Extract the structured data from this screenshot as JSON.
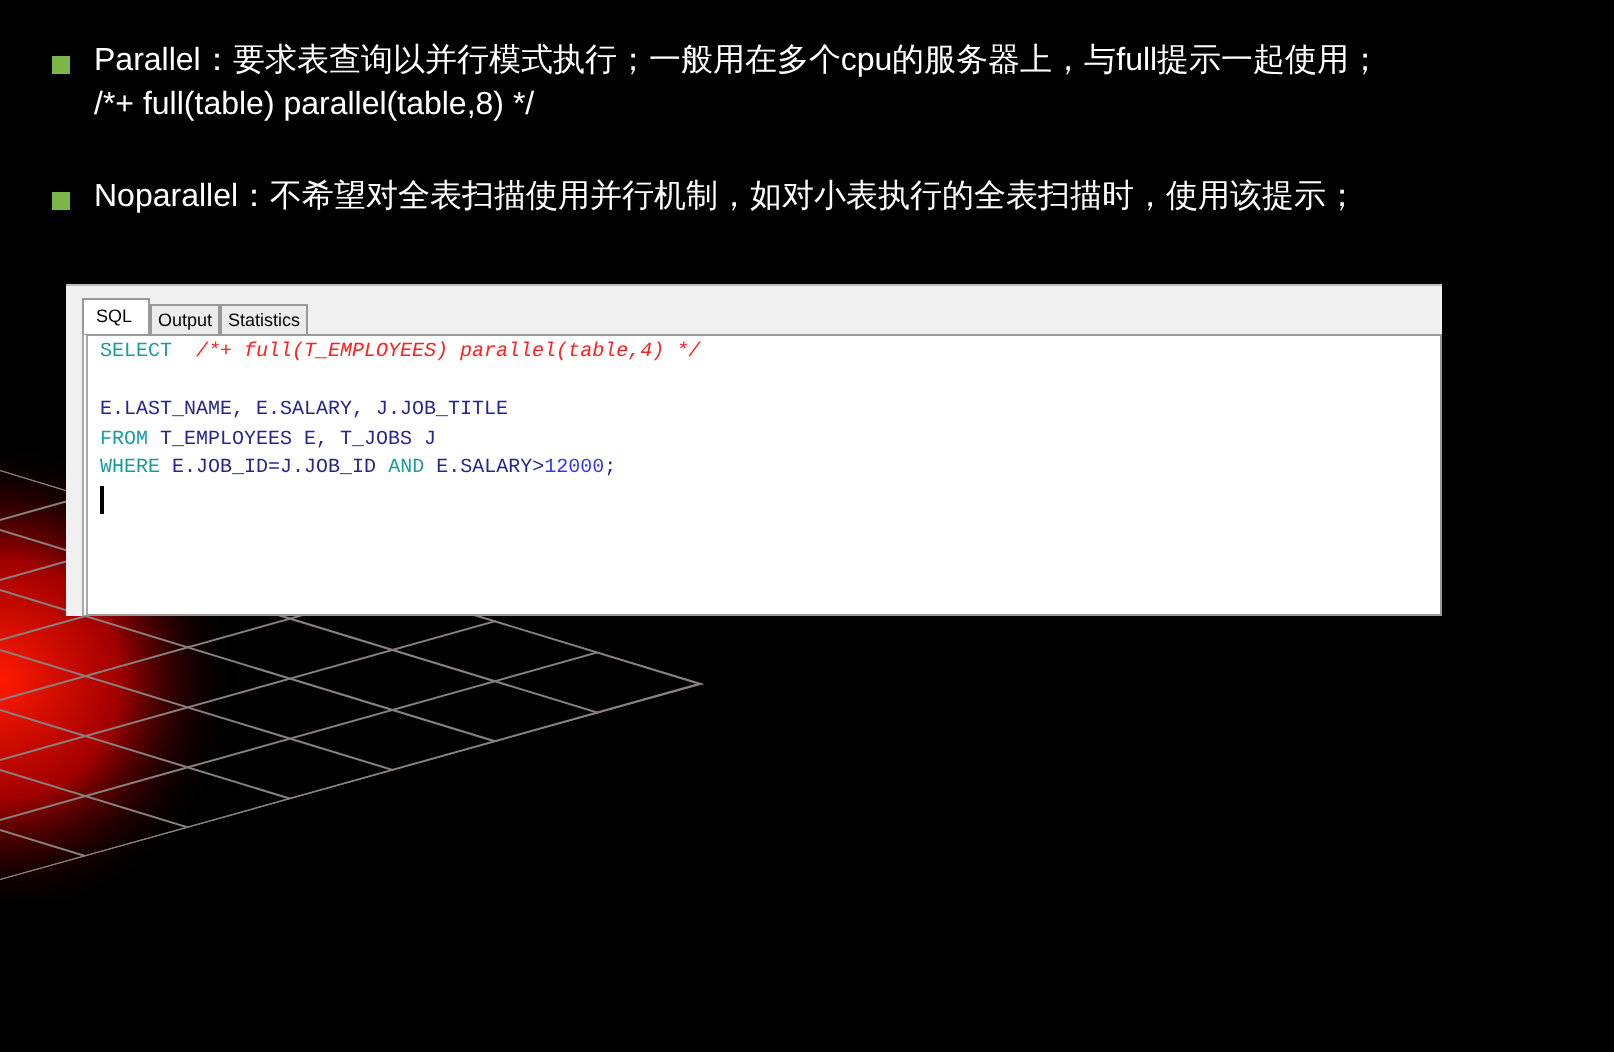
{
  "bullets": [
    {
      "term": "Parallel",
      "text": "：要求表查询以并行模式执行；一般用在多个cpu的服务器上，与full提示一起使用；",
      "example": "/*+ full(table) parallel(table,8) */"
    },
    {
      "term": "Noparallel",
      "text": "：不希望对全表扫描使用并行机制，如对小表执行的全表扫描时，使用该提示；"
    }
  ],
  "editor": {
    "tabs": [
      {
        "label": "SQL",
        "selected": true
      },
      {
        "label": "Output",
        "selected": false
      },
      {
        "label": "Statistics",
        "selected": false
      }
    ],
    "blocks": [
      [
        [
          {
            "kind": "keyword",
            "text": "SELECT"
          },
          {
            "kind": "comment",
            "text": "/*+ full(T_EMPLOYEES) parallel(table,4) */"
          }
        ]
      ],
      [
        [
          {
            "kind": "ident",
            "text": "E.LAST_NAME, E.SALARY, J.JOB_TITLE"
          }
        ],
        [
          {
            "kind": "keyword",
            "text": "FROM"
          },
          {
            "kind": "ident",
            "text": "T_EMPLOYEES E, T_JOBS J"
          }
        ],
        [
          {
            "kind": "keyword",
            "text": "WHERE"
          },
          {
            "kind": "ident",
            "text": "E.JOB_ID=J.JOB_ID"
          },
          {
            "kind": "keyword",
            "text": "AND"
          },
          {
            "kind": "ident",
            "text": "E.SALARY>"
          },
          {
            "kind": "number",
            "text": "12000"
          },
          {
            "kind": "ident",
            "text": ";"
          }
        ]
      ]
    ]
  }
}
